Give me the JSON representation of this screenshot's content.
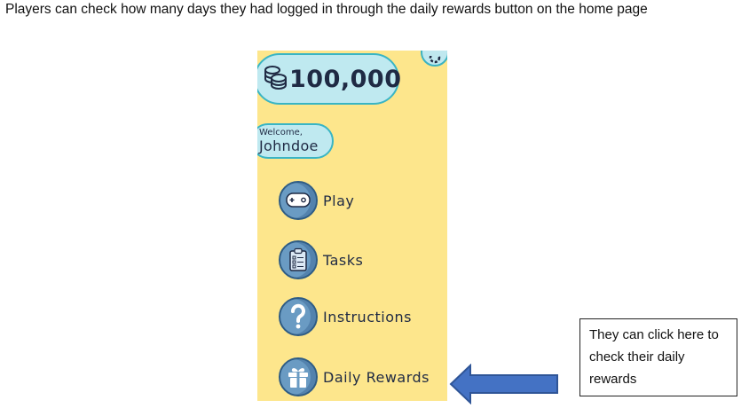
{
  "doc": {
    "caption": "Players can check how many days they had logged in through the daily rewards button on the home page"
  },
  "app": {
    "coins": "100,000",
    "welcome_label": "Welcome,",
    "username": "Johndoe",
    "menu": [
      {
        "label": "Play",
        "icon": "gamepad-icon"
      },
      {
        "label": "Tasks",
        "icon": "clipboard-icon"
      },
      {
        "label": "Instructions",
        "icon": "question-mark-icon"
      },
      {
        "label": "Daily Rewards",
        "icon": "gift-icon"
      }
    ]
  },
  "callout": {
    "text": "They can click here to check their daily rewards"
  },
  "colors": {
    "app_background": "#fde68c",
    "pill_fill": "#bfe9f0",
    "pill_border": "#39b5c4",
    "icon_fill": "#6a9bc3",
    "arrow_fill": "#4472c4"
  }
}
